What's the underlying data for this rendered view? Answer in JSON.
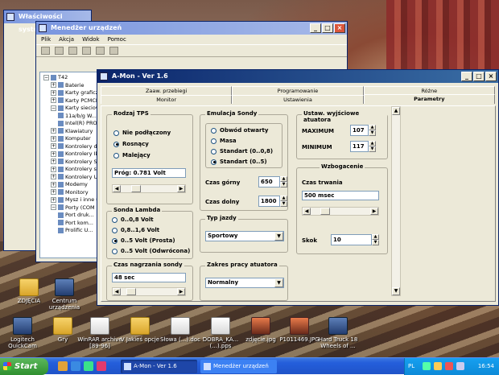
{
  "desktop_icons": [
    {
      "label": "ZDJĘCIA",
      "type": "folder"
    },
    {
      "label": "Centrum urządzenia",
      "type": "app"
    },
    {
      "label": "Logitech QuickCam",
      "type": "app"
    },
    {
      "label": "Gry",
      "type": "folder"
    },
    {
      "label": "WinRAR archive [89-96]",
      "type": "file"
    },
    {
      "label": "V Jakieś opcje",
      "type": "folder"
    },
    {
      "label": "Słowa (...).doc",
      "type": "file"
    },
    {
      "label": "DOBRA_KA...(...).pps",
      "type": "file"
    },
    {
      "label": "zdjęcie.jpg",
      "type": "img"
    },
    {
      "label": "P1011469.JPG",
      "type": "img"
    },
    {
      "label": "Hard Truck 18 Wheels of ...",
      "type": "app"
    }
  ],
  "behind_window": {
    "title": "Właściwości systemu"
  },
  "device_manager": {
    "title": "Menedżer urządzeń",
    "menu": [
      "Plik",
      "Akcja",
      "Widok",
      "Pomoc"
    ],
    "tree": [
      {
        "label": "T42",
        "level": 0,
        "expanded": true
      },
      {
        "label": "Baterie",
        "level": 1,
        "expanded": false
      },
      {
        "label": "Karty graficzne",
        "level": 1,
        "expanded": false
      },
      {
        "label": "Karty PCMCIA",
        "level": 1,
        "expanded": false
      },
      {
        "label": "Karty sieciowe",
        "level": 1,
        "expanded": true
      },
      {
        "label": "11a/b/g W...",
        "level": 2,
        "expanded": null
      },
      {
        "label": "Intel(R) PRO...",
        "level": 2,
        "expanded": null
      },
      {
        "label": "Klawiatury",
        "level": 1,
        "expanded": false
      },
      {
        "label": "Komputer",
        "level": 1,
        "expanded": false
      },
      {
        "label": "Kontrolery dź...",
        "level": 1,
        "expanded": false
      },
      {
        "label": "Kontrolery ID...",
        "level": 1,
        "expanded": false
      },
      {
        "label": "Kontrolery S...",
        "level": 1,
        "expanded": false
      },
      {
        "label": "Kontrolery st...",
        "level": 1,
        "expanded": false
      },
      {
        "label": "Kontrolery U...",
        "level": 1,
        "expanded": false
      },
      {
        "label": "Modemy",
        "level": 1,
        "expanded": false
      },
      {
        "label": "Monitory",
        "level": 1,
        "expanded": false
      },
      {
        "label": "Mysz i inne u...",
        "level": 1,
        "expanded": false
      },
      {
        "label": "Porty (COM i...",
        "level": 1,
        "expanded": true
      },
      {
        "label": "Port druk...",
        "level": 2,
        "expanded": null
      },
      {
        "label": "Port kom...",
        "level": 2,
        "expanded": null
      },
      {
        "label": "Prolific U...",
        "level": 2,
        "expanded": null
      }
    ]
  },
  "amon": {
    "title": "A-Mon - Ver 1.6",
    "tabs_row1": [
      "Zaaw. przebiegi",
      "Programowanie",
      "Różne"
    ],
    "tabs_row2": [
      "Monitor",
      "Ustawienia",
      "Parametry"
    ],
    "active_tab": "Parametry",
    "tps": {
      "legend": "Rodzaj TPS",
      "options": [
        "Nie podłączony",
        "Rosnący",
        "Malejący"
      ],
      "selected": 1,
      "value_text": "Próg: 0.781 Volt",
      "slider_fraction": 0.22
    },
    "lambda": {
      "legend": "Sonda Lambda",
      "options": [
        "0..0,8 Volt",
        "0,8..1,6 Volt",
        "0..5 Volt (Prosta)",
        "0..5 Volt (Odwrócona)"
      ],
      "selected": 2
    },
    "recording": {
      "legend": "Czas nagrzania sondy",
      "value": "48 sec",
      "slider_fraction": 0.12
    },
    "probe_emulation": {
      "legend": "Emulacja Sondy",
      "options": [
        "Obwód otwarty",
        "Masa",
        "Standart (0..0,8)",
        "Standart (0..5)"
      ],
      "selected": 3,
      "top_time_label": "Czas górny",
      "top_time_value": "650",
      "bottom_time_label": "Czas dolny",
      "bottom_time_value": "1800"
    },
    "driving_type": {
      "legend": "Typ jazdy",
      "value": "Sportowy"
    },
    "actuator_range": {
      "legend": "Zakres pracy atuatora",
      "value": "Normalny"
    },
    "actuator_out": {
      "legend": "Ustaw. wyjściowe atuatora",
      "max_label": "MAXIMUM",
      "max_value": "107",
      "min_label": "MINIMUM",
      "min_value": "117"
    },
    "enrichment": {
      "legend": "Wzbogacenie",
      "duration_label": "Czas trwania",
      "duration_value": "500 msec",
      "slider_fraction": 0.18,
      "step_label": "Skok",
      "step_value": "10"
    }
  },
  "taskbar": {
    "start_label": "Start",
    "tasks": [
      {
        "label": "A-Mon - Ver 1.6",
        "active": true
      },
      {
        "label": "Menedżer urządzeń",
        "active": false
      }
    ],
    "lang": "PL",
    "clock": "16:54"
  }
}
